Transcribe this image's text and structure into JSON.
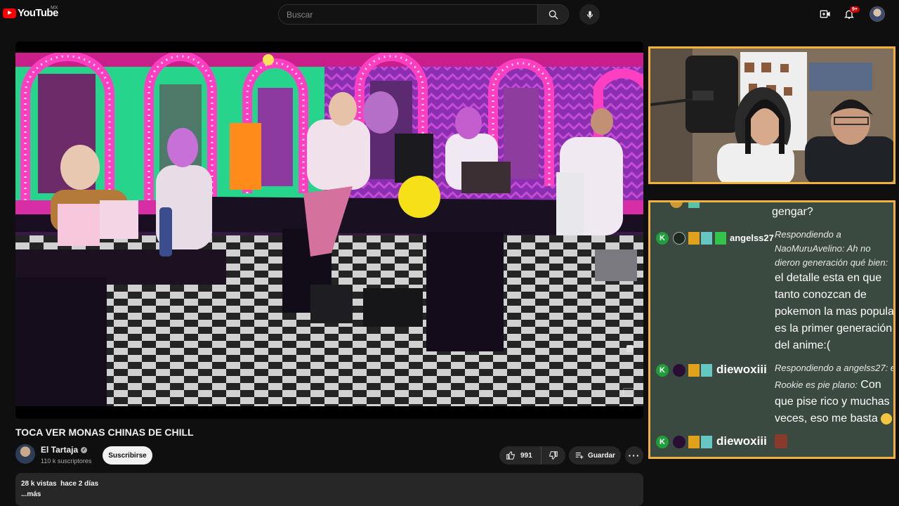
{
  "header": {
    "logo_text": "YouTube",
    "country": "MX",
    "search_placeholder": "Buscar",
    "notification_count": "9+"
  },
  "video": {
    "title": "TOCA VER MONAS CHINAS DE CHILL",
    "channel": "El Tartaja",
    "subscribers": "110 k suscriptores",
    "subscribe_label": "Suscribirse",
    "likes": "991",
    "save_label": "Guardar",
    "views": "28 k vistas",
    "age": "hace 2 días",
    "more_label": "...más"
  },
  "chat": {
    "partial_message": "gengar?",
    "messages": [
      {
        "user": "angelss27",
        "reply_to": "Respondiendo a NaoMuruAvelino: Ah no dieron generación qué bien:",
        "text": "el detalle esta en que tanto conozcan de pokemon la mas popular es la primer generación del anime:("
      },
      {
        "user": "diewoxiii",
        "reply_to": "Respondiendo a angelss27: el Rookie es pie plano:",
        "text": "Con que pise rico y muchas veces, eso me basta"
      },
      {
        "user": "diewoxiii",
        "reply_to": "",
        "text": ""
      }
    ]
  },
  "colors": {
    "bg": "#0f0f0f",
    "accent_red": "#ff0000",
    "overlay_border": "#f2b23a",
    "chat_bg": "#3a4a40"
  },
  "icons": [
    "youtube-logo-icon",
    "search-icon",
    "mic-icon",
    "create-video-icon",
    "bell-icon",
    "thumbs-up-icon",
    "thumbs-down-icon",
    "playlist-add-icon",
    "more-icon",
    "verified-icon"
  ]
}
